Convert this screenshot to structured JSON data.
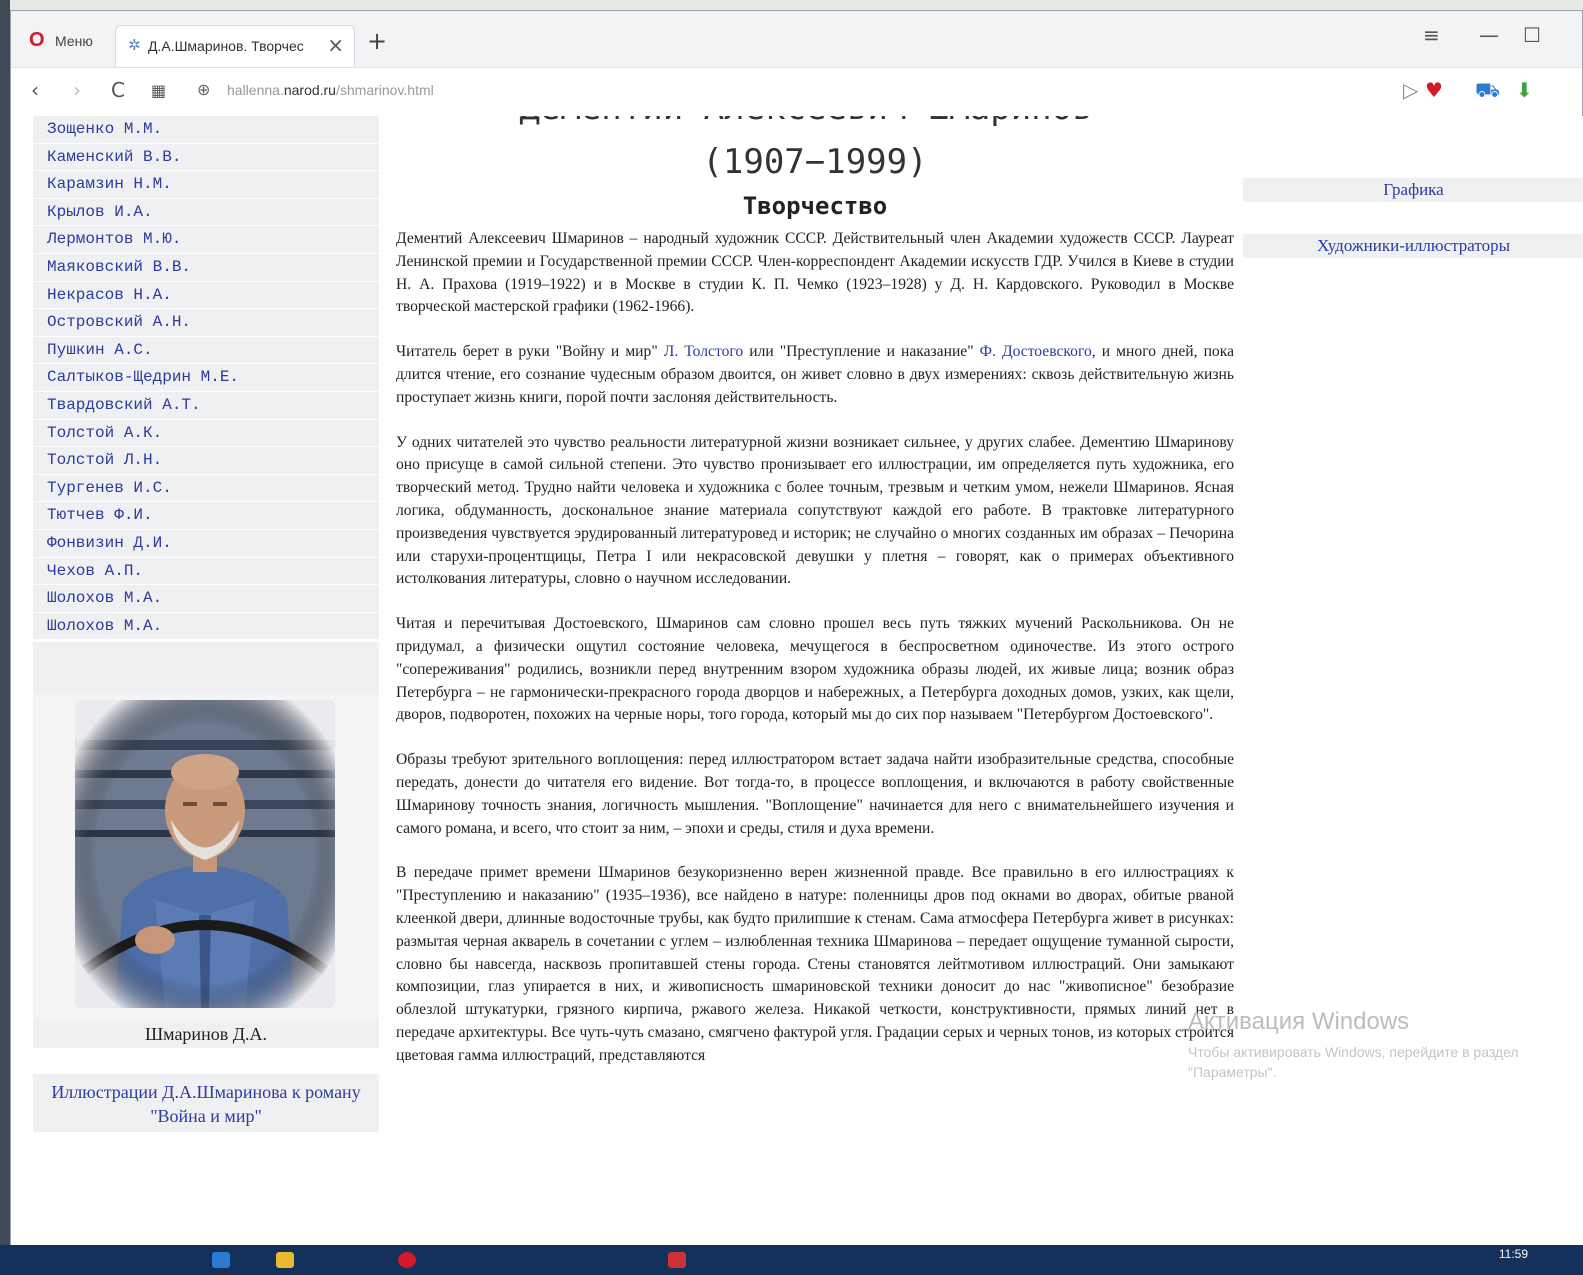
{
  "browser": {
    "menu_label": "Меню",
    "tab_title": "Д.А.Шмаринов. Творчес",
    "url_domain_prefix": "hallenna.",
    "url_domain": "narod.ru",
    "url_path": "/shmarinov.html"
  },
  "left_nav": {
    "authors": [
      "Зощенко М.М.",
      "Каменский В.В.",
      "Карамзин Н.М.",
      "Крылов И.А.",
      "Лермонтов М.Ю.",
      "Маяковский В.В.",
      "Некрасов Н.А.",
      "Островский А.Н.",
      "Пушкин А.С.",
      "Салтыков-Щедрин М.Е.",
      "Твардовский А.Т.",
      "Толстой А.К.",
      "Толстой Л.Н.",
      "Тургенев И.С.",
      "Тютчев Ф.И.",
      "Фонвизин Д.И.",
      "Чехов А.П.",
      "Шолохов М.А.",
      "Шолохов М.А."
    ],
    "portrait_caption": "Шмаринов Д.А.",
    "illustrations_link": "Иллюстрации Д.А.Шмаринова к роману \"Война и мир\""
  },
  "article": {
    "cut_heading": "Дементий Алексеевич Шмаринов",
    "years": "(1907−1999)",
    "section_title": "Творчество",
    "p1": "Дементий Алексеевич Шмаринов – народный художник СССР. Действительный член Академии художеств СССР. Лауреат Ленинской премии и Государственной премии СССР. Член-корреспондент Академии искусств ГДР. Учился в Киеве в студии Н. А. Прахова (1919–1922) и в Москве в студии К. П. Чемко (1923–1928) у Д. Н. Кардовского. Руководил в Москве творческой мастерской графики (1962-1966).",
    "p2_a": "Читатель берет в руки \"Войну и мир\" ",
    "p2_link1": "Л. Толстого",
    "p2_b": " или \"Преступление и наказание\" ",
    "p2_link2": "Ф. Достоевского",
    "p2_c": ", и много дней, пока длится чтение, его сознание чудесным образом двоится, он живет словно в двух измерениях: сквозь действительную жизнь проступает жизнь книги, порой почти заслоняя действительность.",
    "p3": "У одних читателей это чувство реальности литературной жизни возникает сильнее, у других слабее. Дементию Шмаринову оно присуще в самой сильной степени. Это чувство пронизывает его иллюстрации, им определяется путь художника, его творческий метод. Трудно найти человека и художника с более точным, трезвым и четким умом, нежели Шмаринов. Ясная логика, обдуманность, доскональное знание материала сопутствуют каждой его работе. В трактовке литературного произведения чувствуется эрудированный литературовед и историк; не случайно о многих созданных им образах – Печорина или старухи-процентщицы, Петра I или некрасовской девушки у плетня – говорят, как о примерах объективного истолкования литературы, словно о научном исследовании.",
    "p4": "Читая и перечитывая Достоевского, Шмаринов сам словно прошел весь путь тяжких мучений Раскольникова. Он не придумал, а физически ощутил состояние человека, мечущегося в беспросветном одиночестве. Из этого острого \"сопереживания\" родились, возникли перед внутренним взором художника образы людей, их живые лица; возник образ Петербурга – не гармонически-прекрасного города дворцов и набережных, а Петербурга доходных домов, узких, как щели, дворов, подворотен, похожих на черные норы, того города, который мы до сих пор называем \"Петербургом Достоевского\".",
    "p5": "Образы требуют зрительного воплощения: перед иллюстратором встает задача найти изобразительные средства, способные передать, донести до читателя его видение. Вот тогда-то, в процессе воплощения, и включаются в работу свойственные Шмаринову точность знания, логичность мышления. \"Воплощение\" начинается для него с внимательнейшего изучения и самого романа, и всего, что стоит за ним, – эпохи и среды, стиля и духа времени.",
    "p6": "В передаче примет времени Шмаринов безукоризненно верен жизненной правде. Все правильно в его иллюстрациях к \"Преступлению и наказанию\" (1935–1936), все найдено в натуре: поленницы дров под окнами во дворах, обитые рваной клеенкой двери, длинные водосточные трубы, как будто прилипшие к стенам. Сама атмосфера Петербурга живет в рисунках: размытая черная акварель в сочетании с углем – излюбленная техника Шмаринова – передает ощущение туманной сырости, словно бы навсегда, насквозь пропитавшей стены города. Стены становятся лейтмотивом иллюстраций. Они замыкают композиции, глаз упирается в них, и живописность шмариновской техники доносит до нас \"живописное\" безобразие облезлой штукатурки, грязного кирпича, ржавого железа. Никакой четкости, конструктивности, прямых линий нет в передаче архитектуры. Все чуть-чуть смазано, смягчено фактурой угля. Градации серых и черных тонов, из которых строится цветовая гамма иллюстраций, представляются"
  },
  "right_nav": {
    "grafika": "Графика",
    "illustrators": "Художники-иллюстраторы"
  },
  "watermark": {
    "title": "Активация Windows",
    "subtitle": "Чтобы активировать Windows, перейдите в раздел \"Параметры\"."
  },
  "taskbar": {
    "clock": "11:59"
  },
  "colors": {
    "link": "#2d3aa0",
    "nav_bg": "#eef0f1",
    "opera_red": "#d11a2a"
  }
}
